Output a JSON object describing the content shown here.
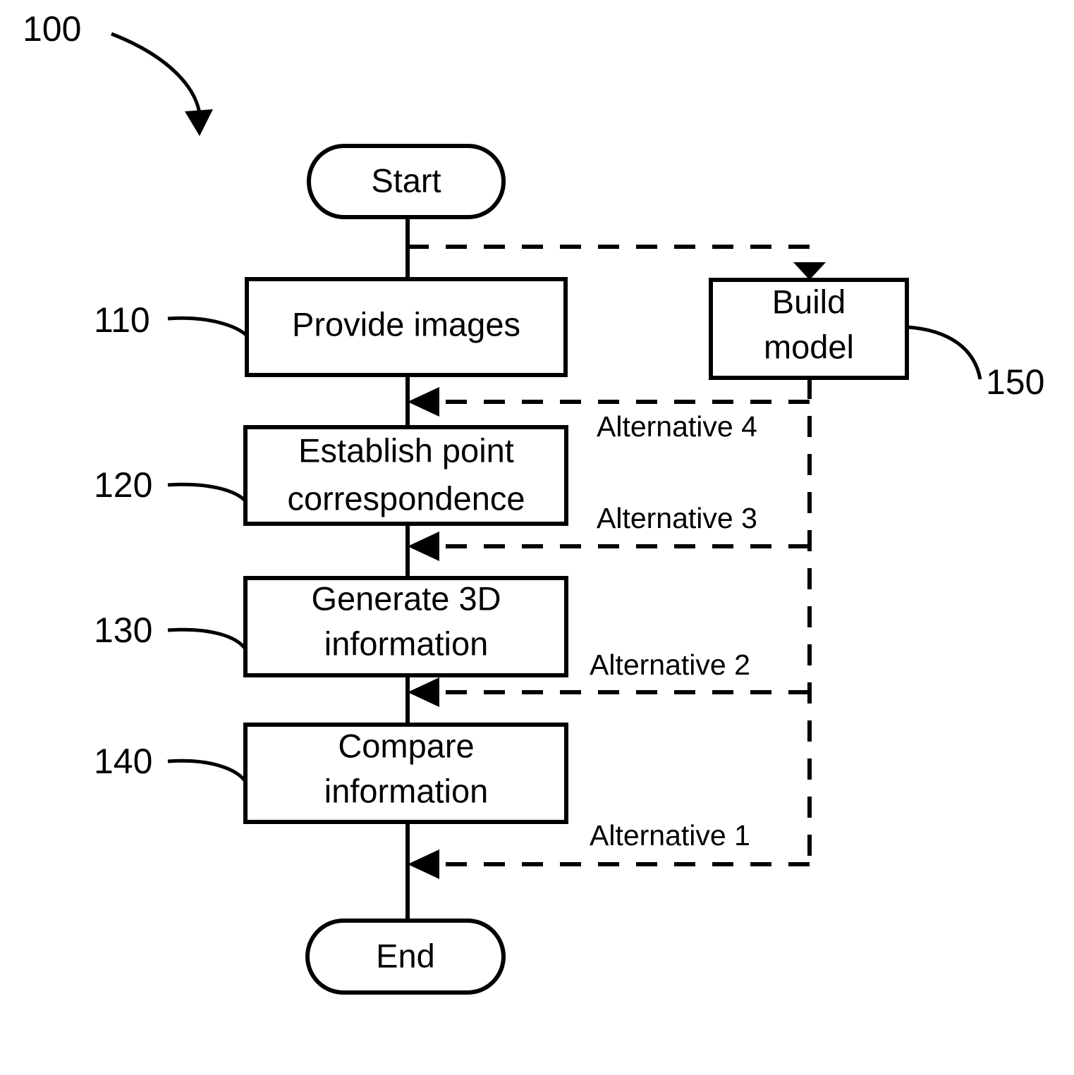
{
  "figure": {
    "number": "100",
    "type": "flowchart",
    "title": ""
  },
  "nodes": [
    {
      "id": "start",
      "label": "Start",
      "shape": "pill",
      "ref": ""
    },
    {
      "id": "provide",
      "label": "Provide images",
      "shape": "rectangle",
      "ref": "110"
    },
    {
      "id": "establish",
      "label": "Establish point correspondence",
      "line1": "Establish point",
      "line2": "correspondence",
      "shape": "rectangle",
      "ref": "120"
    },
    {
      "id": "generate",
      "label": "Generate 3D information",
      "line1": "Generate 3D",
      "line2": "information",
      "shape": "rectangle",
      "ref": "130"
    },
    {
      "id": "compare",
      "label": "Compare information",
      "line1": "Compare",
      "line2": "information",
      "shape": "rectangle",
      "ref": "140"
    },
    {
      "id": "end",
      "label": "End",
      "shape": "pill",
      "ref": ""
    },
    {
      "id": "build",
      "label": "Build model",
      "line1": "Build",
      "line2": "model",
      "shape": "rectangle",
      "ref": "150"
    }
  ],
  "reference_numerals": {
    "figure": "100",
    "provide_images": "110",
    "establish_point_correspondence": "120",
    "generate_3d_information": "130",
    "compare_information": "140",
    "build_model": "150"
  },
  "alternatives": [
    {
      "id": "alt4",
      "label": "Alternative 4",
      "target": "Provide images"
    },
    {
      "id": "alt3",
      "label": "Alternative 3",
      "target": "Establish point correspondence"
    },
    {
      "id": "alt2",
      "label": "Alternative 2",
      "target": "Generate 3D information"
    },
    {
      "id": "alt1",
      "label": "Alternative 1",
      "target": "Compare information"
    }
  ],
  "colors": {
    "stroke": "#000000",
    "fill": "#ffffff",
    "background": "#ffffff"
  }
}
